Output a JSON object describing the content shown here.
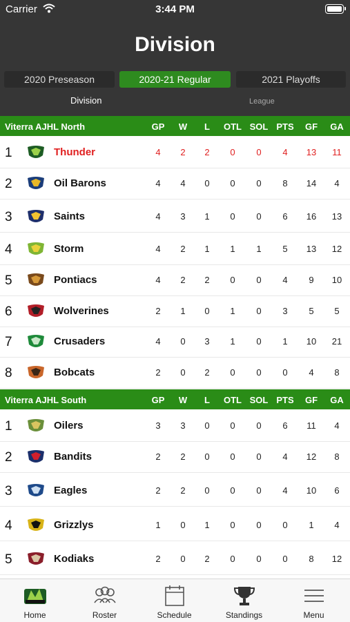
{
  "status_bar": {
    "carrier": "Carrier",
    "time": "3:44 PM"
  },
  "page": {
    "title": "Division"
  },
  "seasons": [
    {
      "label": "2020 Preseason",
      "active": false
    },
    {
      "label": "2020-21 Regular",
      "active": true
    },
    {
      "label": "2021 Playoffs",
      "active": false
    }
  ],
  "subtabs": [
    {
      "label": "Division",
      "active": true
    },
    {
      "label": "League",
      "active": false
    }
  ],
  "columns": [
    "GP",
    "W",
    "L",
    "OTL",
    "SOL",
    "PTS",
    "GF",
    "GA"
  ],
  "divisions": [
    {
      "name": "Viterra AJHL North",
      "teams": [
        {
          "rank": "1",
          "name": "Thunder",
          "stats": [
            "4",
            "2",
            "2",
            "0",
            "0",
            "4",
            "13",
            "11"
          ],
          "highlight": true,
          "logo": "thunder-logo"
        },
        {
          "rank": "2",
          "name": "Oil Barons",
          "stats": [
            "4",
            "4",
            "0",
            "0",
            "0",
            "8",
            "14",
            "4"
          ],
          "highlight": false,
          "logo": "oil-barons-logo"
        },
        {
          "rank": "3",
          "name": "Saints",
          "stats": [
            "4",
            "3",
            "1",
            "0",
            "0",
            "6",
            "16",
            "13"
          ],
          "highlight": false,
          "logo": "saints-logo"
        },
        {
          "rank": "4",
          "name": "Storm",
          "stats": [
            "4",
            "2",
            "1",
            "1",
            "1",
            "5",
            "13",
            "12"
          ],
          "highlight": false,
          "logo": "storm-logo"
        },
        {
          "rank": "5",
          "name": "Pontiacs",
          "stats": [
            "4",
            "2",
            "2",
            "0",
            "0",
            "4",
            "9",
            "10"
          ],
          "highlight": false,
          "logo": "pontiacs-logo"
        },
        {
          "rank": "6",
          "name": "Wolverines",
          "stats": [
            "2",
            "1",
            "0",
            "1",
            "0",
            "3",
            "5",
            "5"
          ],
          "highlight": false,
          "logo": "wolverines-logo"
        },
        {
          "rank": "7",
          "name": "Crusaders",
          "stats": [
            "4",
            "0",
            "3",
            "1",
            "0",
            "1",
            "10",
            "21"
          ],
          "highlight": false,
          "logo": "crusaders-logo"
        },
        {
          "rank": "8",
          "name": "Bobcats",
          "stats": [
            "2",
            "0",
            "2",
            "0",
            "0",
            "0",
            "4",
            "8"
          ],
          "highlight": false,
          "logo": "bobcats-logo"
        }
      ]
    },
    {
      "name": "Viterra AJHL South",
      "teams": [
        {
          "rank": "1",
          "name": "Oilers",
          "stats": [
            "3",
            "3",
            "0",
            "0",
            "0",
            "6",
            "11",
            "4"
          ],
          "highlight": false,
          "logo": "oilers-logo"
        },
        {
          "rank": "2",
          "name": "Bandits",
          "stats": [
            "2",
            "2",
            "0",
            "0",
            "0",
            "4",
            "12",
            "8"
          ],
          "highlight": false,
          "logo": "bandits-logo"
        },
        {
          "rank": "3",
          "name": "Eagles",
          "stats": [
            "2",
            "2",
            "0",
            "0",
            "0",
            "4",
            "10",
            "6"
          ],
          "highlight": false,
          "logo": "eagles-logo"
        },
        {
          "rank": "4",
          "name": "Grizzlys",
          "stats": [
            "1",
            "0",
            "1",
            "0",
            "0",
            "0",
            "1",
            "4"
          ],
          "highlight": false,
          "logo": "grizzlys-logo"
        },
        {
          "rank": "5",
          "name": "Kodiaks",
          "stats": [
            "2",
            "0",
            "2",
            "0",
            "0",
            "0",
            "8",
            "12"
          ],
          "highlight": false,
          "logo": "kodiaks-logo"
        }
      ]
    }
  ],
  "tabbar": [
    {
      "label": "Home",
      "icon": "team-logo-icon"
    },
    {
      "label": "Roster",
      "icon": "people-icon"
    },
    {
      "label": "Schedule",
      "icon": "calendar-icon"
    },
    {
      "label": "Standings",
      "icon": "trophy-icon"
    },
    {
      "label": "Menu",
      "icon": "menu-icon"
    }
  ],
  "colors": {
    "header_bg": "#363636",
    "accent_green": "#2a8c17",
    "highlight_red": "#e02020"
  }
}
